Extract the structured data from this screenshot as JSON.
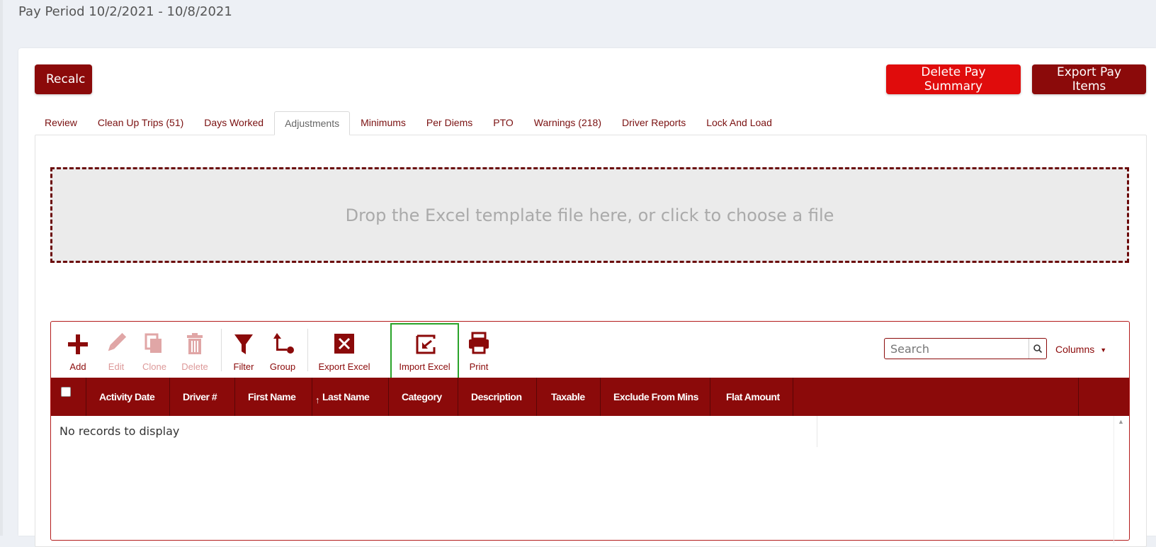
{
  "page": {
    "title": "Pay Period 10/2/2021 - 10/8/2021"
  },
  "actions": {
    "recalc": "Recalc",
    "delete_pay_summary": "Delete Pay Summary",
    "export_pay_items": "Export Pay Items"
  },
  "tabs": [
    {
      "label": "Review",
      "active": false
    },
    {
      "label": "Clean Up Trips (51)",
      "active": false
    },
    {
      "label": "Days Worked",
      "active": false
    },
    {
      "label": "Adjustments",
      "active": true
    },
    {
      "label": "Minimums",
      "active": false
    },
    {
      "label": "Per Diems",
      "active": false
    },
    {
      "label": "PTO",
      "active": false
    },
    {
      "label": "Warnings (218)",
      "active": false
    },
    {
      "label": "Driver Reports",
      "active": false
    },
    {
      "label": "Lock And Load",
      "active": false
    }
  ],
  "dropzone": {
    "text": "Drop the Excel template file here, or click to choose a file"
  },
  "toolbar": {
    "add": "Add",
    "edit": "Edit",
    "clone": "Clone",
    "delete": "Delete",
    "filter": "Filter",
    "group": "Group",
    "export_excel": "Export Excel",
    "import_excel": "Import Excel",
    "print": "Print"
  },
  "search": {
    "placeholder": "Search"
  },
  "columns_button": "Columns",
  "grid": {
    "columns": [
      "Activity Date",
      "Driver #",
      "First Name",
      "Last Name",
      "Category",
      "Description",
      "Taxable",
      "Exclude From Mins",
      "Flat Amount"
    ],
    "sorted_column": "Last Name",
    "empty_text": "No records to display"
  },
  "colors": {
    "primary": "#8b0a0a",
    "danger": "#e00c0c",
    "highlight": "#29a329"
  }
}
